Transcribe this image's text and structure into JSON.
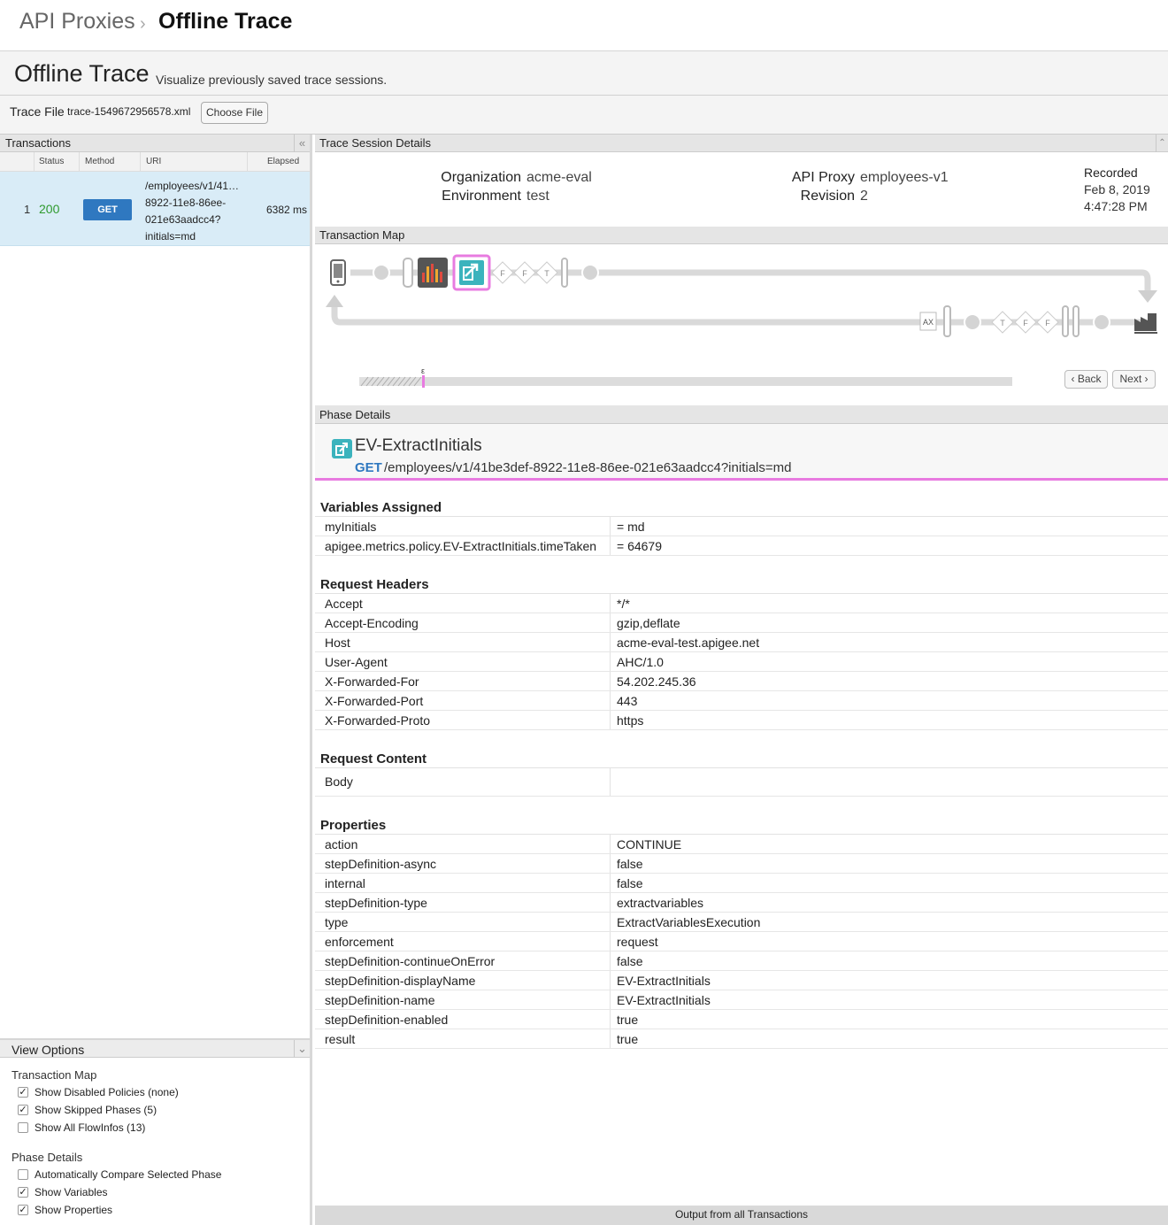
{
  "breadcrumb": {
    "parent": "API Proxies",
    "current": "Offline Trace"
  },
  "header": {
    "title": "Offline Trace",
    "subtitle": "Visualize previously saved trace sessions."
  },
  "trace_file": {
    "label": "Trace File",
    "filename": "trace-1549672956578.xml",
    "choose_label": "Choose File"
  },
  "transactions": {
    "title": "Transactions",
    "columns": {
      "status": "Status",
      "method": "Method",
      "uri": "URI",
      "elapsed": "Elapsed"
    },
    "rows": [
      {
        "num": "1",
        "status": "200",
        "method": "GET",
        "uri_lines": [
          "/employees/v1/41…",
          "8922-11e8-86ee-",
          "021e63aadcc4?",
          "initials=md"
        ],
        "elapsed": "6382 ms"
      }
    ]
  },
  "session": {
    "title": "Trace Session Details",
    "org_label": "Organization",
    "org_value": "acme-eval",
    "env_label": "Environment",
    "env_value": "test",
    "proxy_label": "API Proxy",
    "proxy_value": "employees-v1",
    "rev_label": "Revision",
    "rev_value": "2",
    "recorded_label": "Recorded",
    "recorded_date": "Feb 8, 2019",
    "recorded_time": "4:47:28 PM"
  },
  "transaction_map": {
    "title": "Transaction Map",
    "request_diamonds": [
      "F",
      "F",
      "T"
    ],
    "response_box": "AX",
    "response_diamonds": [
      "T",
      "F",
      "F"
    ],
    "timeline_marker": "ε",
    "back_label": "Back",
    "next_label": "Next"
  },
  "phase": {
    "title": "Phase Details",
    "policy_name": "EV-ExtractInitials",
    "verb": "GET",
    "path": "/employees/v1/41be3def-8922-11e8-86ee-021e63aadcc4?initials=md",
    "accent": "#e87be0"
  },
  "variables": {
    "title": "Variables Assigned",
    "rows": [
      {
        "k": "myInitials",
        "v": "= md"
      },
      {
        "k": "apigee.metrics.policy.EV-ExtractInitials.timeTaken",
        "v": "= 64679"
      }
    ]
  },
  "request_headers": {
    "title": "Request Headers",
    "rows": [
      {
        "k": "Accept",
        "v": "*/*"
      },
      {
        "k": "Accept-Encoding",
        "v": "gzip,deflate"
      },
      {
        "k": "Host",
        "v": "acme-eval-test.apigee.net"
      },
      {
        "k": "User-Agent",
        "v": "AHC/1.0"
      },
      {
        "k": "X-Forwarded-For",
        "v": "54.202.245.36"
      },
      {
        "k": "X-Forwarded-Port",
        "v": "443"
      },
      {
        "k": "X-Forwarded-Proto",
        "v": "https"
      }
    ]
  },
  "request_content": {
    "title": "Request Content",
    "rows": [
      {
        "k": "Body",
        "v": ""
      }
    ]
  },
  "properties": {
    "title": "Properties",
    "rows": [
      {
        "k": "action",
        "v": "CONTINUE"
      },
      {
        "k": "stepDefinition-async",
        "v": "false"
      },
      {
        "k": "internal",
        "v": "false"
      },
      {
        "k": "stepDefinition-type",
        "v": "extractvariables"
      },
      {
        "k": "type",
        "v": "ExtractVariablesExecution"
      },
      {
        "k": "enforcement",
        "v": "request"
      },
      {
        "k": "stepDefinition-continueOnError",
        "v": "false"
      },
      {
        "k": "stepDefinition-displayName",
        "v": "EV-ExtractInitials"
      },
      {
        "k": "stepDefinition-name",
        "v": "EV-ExtractInitials"
      },
      {
        "k": "stepDefinition-enabled",
        "v": "true"
      },
      {
        "k": "result",
        "v": "true"
      }
    ]
  },
  "view_options": {
    "title": "View Options",
    "map_group": "Transaction Map",
    "map_options": [
      {
        "label": "Show Disabled Policies (none)",
        "checked": true
      },
      {
        "label": "Show Skipped Phases (5)",
        "checked": true
      },
      {
        "label": "Show All FlowInfos (13)",
        "checked": false
      }
    ],
    "phase_group": "Phase Details",
    "phase_options": [
      {
        "label": "Automatically Compare Selected Phase",
        "checked": false
      },
      {
        "label": "Show Variables",
        "checked": true
      },
      {
        "label": "Show Properties",
        "checked": true
      }
    ]
  },
  "footer": {
    "output_label": "Output from all Transactions"
  }
}
